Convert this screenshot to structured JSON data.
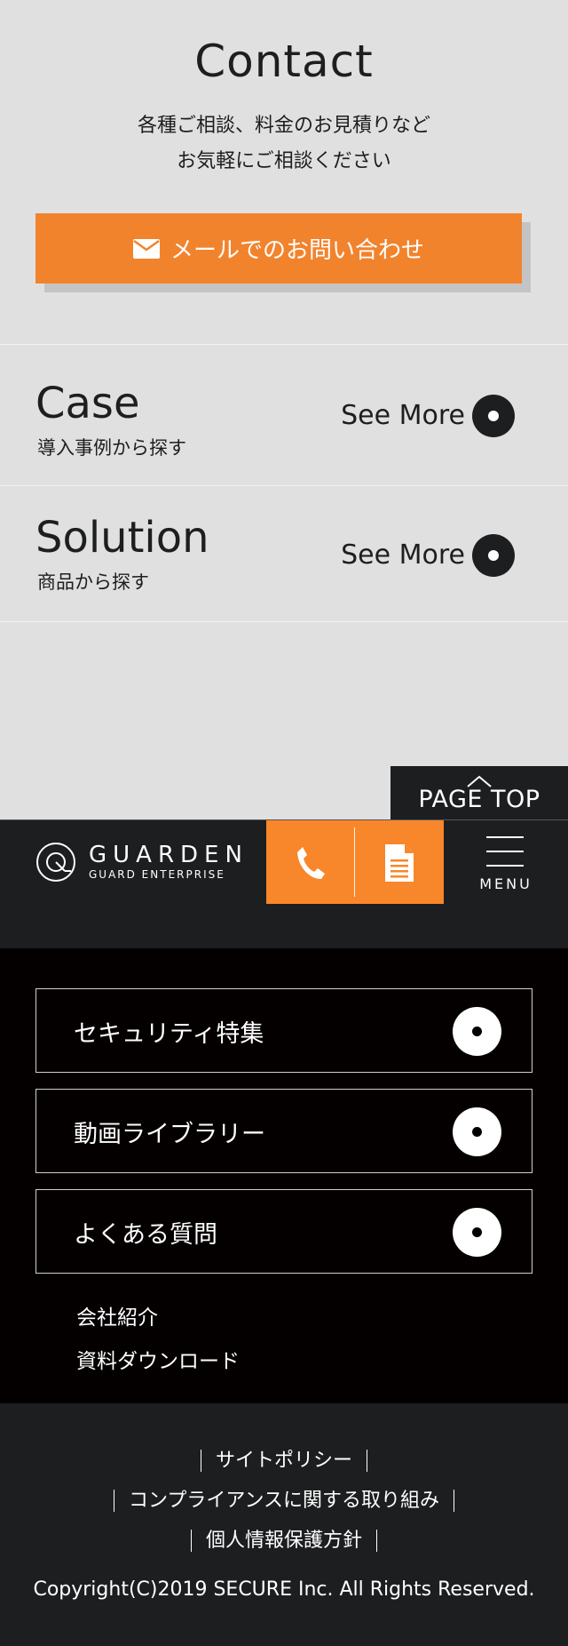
{
  "contact": {
    "title": "Contact",
    "lead_line1": "各種ご相談、料金のお見積りなど",
    "lead_line2": "お気軽にご相談ください",
    "mail_button": "メールでのお問い合わせ"
  },
  "case": {
    "title": "Case",
    "subtitle": "導入事例から探す",
    "see_more": "See More"
  },
  "solution": {
    "title": "Solution",
    "subtitle": "商品から探す",
    "see_more": "See More"
  },
  "page_top": "PAGE TOP",
  "header": {
    "logo_main": "GUARDEN",
    "logo_sub": "GUARD ENTERPRISE",
    "menu_label": "MENU"
  },
  "nav": {
    "boxes": [
      "セキュリティ特集",
      "動画ライブラリー",
      "よくある質問"
    ],
    "links": [
      "会社紹介",
      "資料ダウンロード"
    ]
  },
  "footer": {
    "links": [
      "サイトポリシー",
      "コンプライアンスに関する取り組み",
      "個人情報保護方針"
    ],
    "copyright": "Copyright(C)2019 SECURE Inc. All Rights Reserved."
  },
  "colors": {
    "accent": "#f2832d",
    "dark": "#1d1e20",
    "black": "#040000",
    "light_bg": "#e0e0e0"
  }
}
